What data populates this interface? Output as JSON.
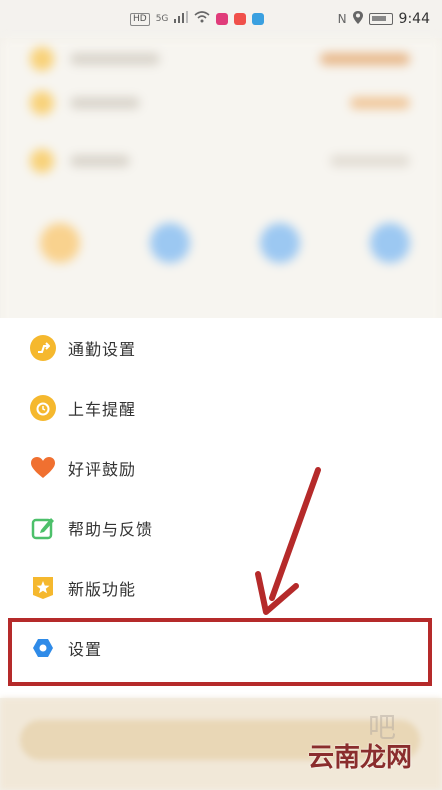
{
  "status_bar": {
    "network_hd": "HD",
    "network_5g": "5G",
    "time": "9:44"
  },
  "menu": {
    "items": [
      {
        "label": "通勤设置",
        "icon": "commute-icon",
        "color": "#f5b82e",
        "glyph": "↗"
      },
      {
        "label": "上车提醒",
        "icon": "alarm-clock-icon",
        "color": "#f5b82e",
        "glyph": "⏰"
      },
      {
        "label": "好评鼓励",
        "icon": "heart-icon",
        "color": "#f07030",
        "glyph": "♥"
      },
      {
        "label": "帮助与反馈",
        "icon": "edit-feedback-icon",
        "color": "#4cc06a",
        "glyph": "✎"
      },
      {
        "label": "新版功能",
        "icon": "star-badge-icon",
        "color": "#f5b82e",
        "glyph": "★"
      },
      {
        "label": "设置",
        "icon": "settings-hexagon-icon",
        "color": "#2f8be8",
        "glyph": "⬢"
      }
    ]
  },
  "watermark": {
    "text": "云南龙网",
    "faint": "吧"
  },
  "colors": {
    "annotation": "#b52a2a"
  }
}
